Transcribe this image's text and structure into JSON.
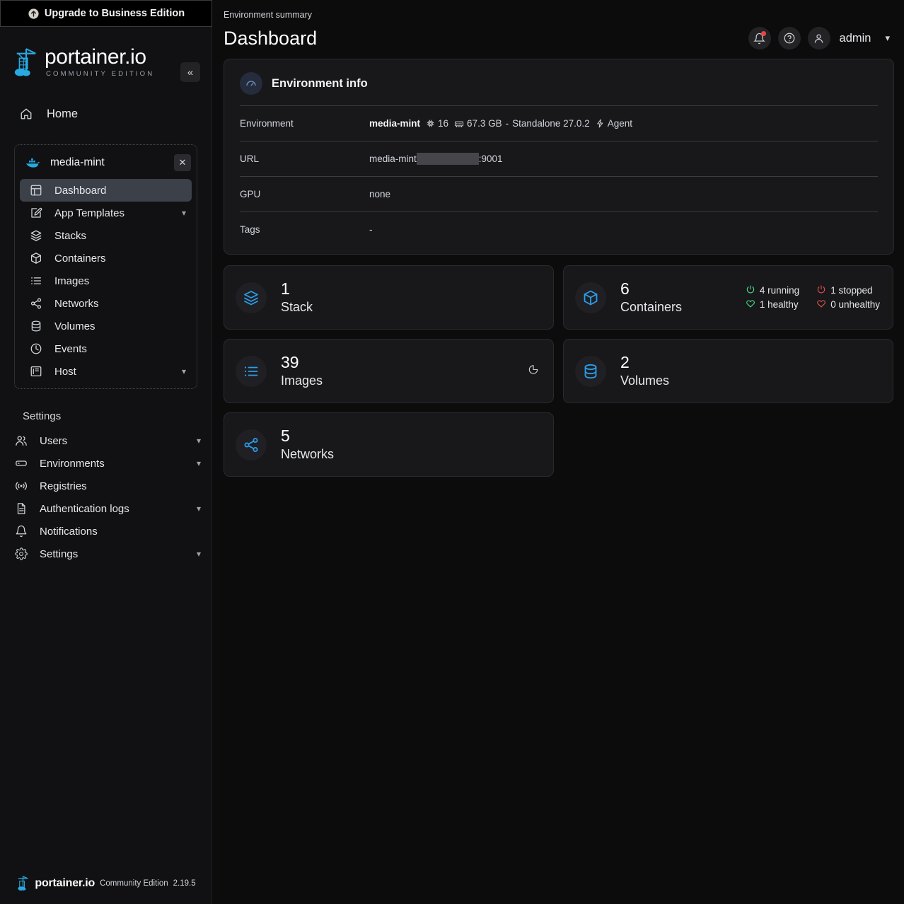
{
  "sidebar": {
    "upgrade_label": "Upgrade to Business Edition",
    "upgrade_icon": "arrow-up-circle-icon",
    "logo_word": "portainer.io",
    "logo_sub": "COMMUNITY EDITION",
    "collapse_icon": "chevron-double-left-icon",
    "home_label": "Home",
    "environment": {
      "name": "media-mint",
      "icon": "docker-whale-icon",
      "close_icon": "close-icon"
    },
    "nav_items": [
      {
        "label": "Dashboard",
        "icon": "dashboard-icon",
        "active": true,
        "chevron": false
      },
      {
        "label": "App Templates",
        "icon": "edit-square-icon",
        "active": false,
        "chevron": true
      },
      {
        "label": "Stacks",
        "icon": "layers-icon",
        "active": false,
        "chevron": false
      },
      {
        "label": "Containers",
        "icon": "box-icon",
        "active": false,
        "chevron": false
      },
      {
        "label": "Images",
        "icon": "list-icon",
        "active": false,
        "chevron": false
      },
      {
        "label": "Networks",
        "icon": "share-nodes-icon",
        "active": false,
        "chevron": false
      },
      {
        "label": "Volumes",
        "icon": "database-icon",
        "active": false,
        "chevron": false
      },
      {
        "label": "Events",
        "icon": "clock-icon",
        "active": false,
        "chevron": false
      },
      {
        "label": "Host",
        "icon": "server-icon",
        "active": false,
        "chevron": true
      }
    ],
    "settings_title": "Settings",
    "settings_items": [
      {
        "label": "Users",
        "icon": "users-icon",
        "chevron": true
      },
      {
        "label": "Environments",
        "icon": "environments-icon",
        "chevron": true
      },
      {
        "label": "Registries",
        "icon": "radio-waves-icon",
        "chevron": false
      },
      {
        "label": "Authentication logs",
        "icon": "document-icon",
        "chevron": true
      },
      {
        "label": "Notifications",
        "icon": "bell-icon",
        "chevron": false
      },
      {
        "label": "Settings",
        "icon": "gear-icon",
        "chevron": true
      }
    ],
    "footer": {
      "word": "portainer.io",
      "edition": "Community Edition",
      "version": "2.19.5"
    }
  },
  "header": {
    "breadcrumb": "Environment summary",
    "title": "Dashboard",
    "notifications_icon": "bell-icon",
    "help_icon": "question-circle-icon",
    "user_icon": "user-icon",
    "user_name": "admin",
    "user_chevron": "chevron-down-icon"
  },
  "env_info": {
    "panel_icon": "gauge-icon",
    "panel_title": "Environment info",
    "rows": [
      {
        "key": "Environment",
        "value": ""
      },
      {
        "key": "URL",
        "value": ""
      },
      {
        "key": "GPU",
        "value": "none"
      },
      {
        "key": "Tags",
        "value": "-"
      }
    ],
    "environment": {
      "name": "media-mint",
      "cpu_icon": "cpu-icon",
      "cpu": "16",
      "ram_icon": "memory-icon",
      "ram": "67.3 GB",
      "separator": "-",
      "mode": "Standalone 27.0.2",
      "agent_icon": "bolt-icon",
      "agent": "Agent"
    },
    "url": {
      "host": "media-mint",
      "redacted": true,
      "port": ":9001"
    }
  },
  "cards": [
    {
      "num": "1",
      "label": "Stack",
      "icon": "layers-icon",
      "stats": []
    },
    {
      "num": "6",
      "label": "Containers",
      "icon": "box-icon",
      "stats": [
        {
          "text": "4 running",
          "icon": "power-icon",
          "tone": "green"
        },
        {
          "text": "1 stopped",
          "icon": "power-icon",
          "tone": "red"
        },
        {
          "text": "1 healthy",
          "icon": "heart-icon",
          "tone": "green"
        },
        {
          "text": "0 unhealthy",
          "icon": "heart-icon",
          "tone": "red"
        }
      ]
    },
    {
      "num": "39",
      "label": "Images",
      "icon": "list-icon",
      "corner_icon": "pie-chart-icon",
      "stats": []
    },
    {
      "num": "2",
      "label": "Volumes",
      "icon": "database-icon",
      "stats": []
    },
    {
      "num": "5",
      "label": "Networks",
      "icon": "share-nodes-icon",
      "stats": []
    }
  ],
  "colors": {
    "accent_blue": "#2a9fea",
    "page_bg": "#0c0c0c",
    "panel_bg": "#18181b",
    "active_nav": "#3b4049",
    "green": "#4ade80",
    "red": "#e0524a",
    "badge_red": "#ef4444"
  }
}
